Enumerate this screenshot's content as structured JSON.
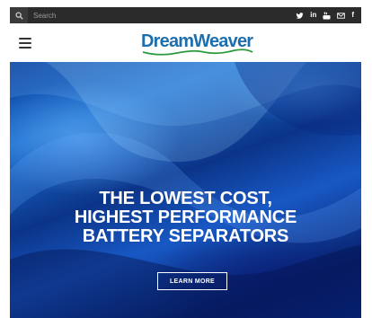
{
  "topbar": {
    "search_placeholder": "Search",
    "social": [
      {
        "icon": "twitter-icon",
        "label": "twitter"
      },
      {
        "icon": "linkedin-icon",
        "label": "in"
      },
      {
        "icon": "youtube-icon",
        "label": "youtube"
      },
      {
        "icon": "email-icon",
        "label": "email"
      },
      {
        "icon": "facebook-icon",
        "label": "f"
      }
    ]
  },
  "header": {
    "logo_part1": "Dream",
    "logo_part2": "Weaver",
    "brand_color": "#1c6fae"
  },
  "hero": {
    "headline_lines": [
      "THE LOWEST COST,",
      "HIGHEST PERFORMANCE",
      "BATTERY SEPARATORS"
    ],
    "cta_label": "LEARN MORE",
    "accent": "#0b3488"
  }
}
